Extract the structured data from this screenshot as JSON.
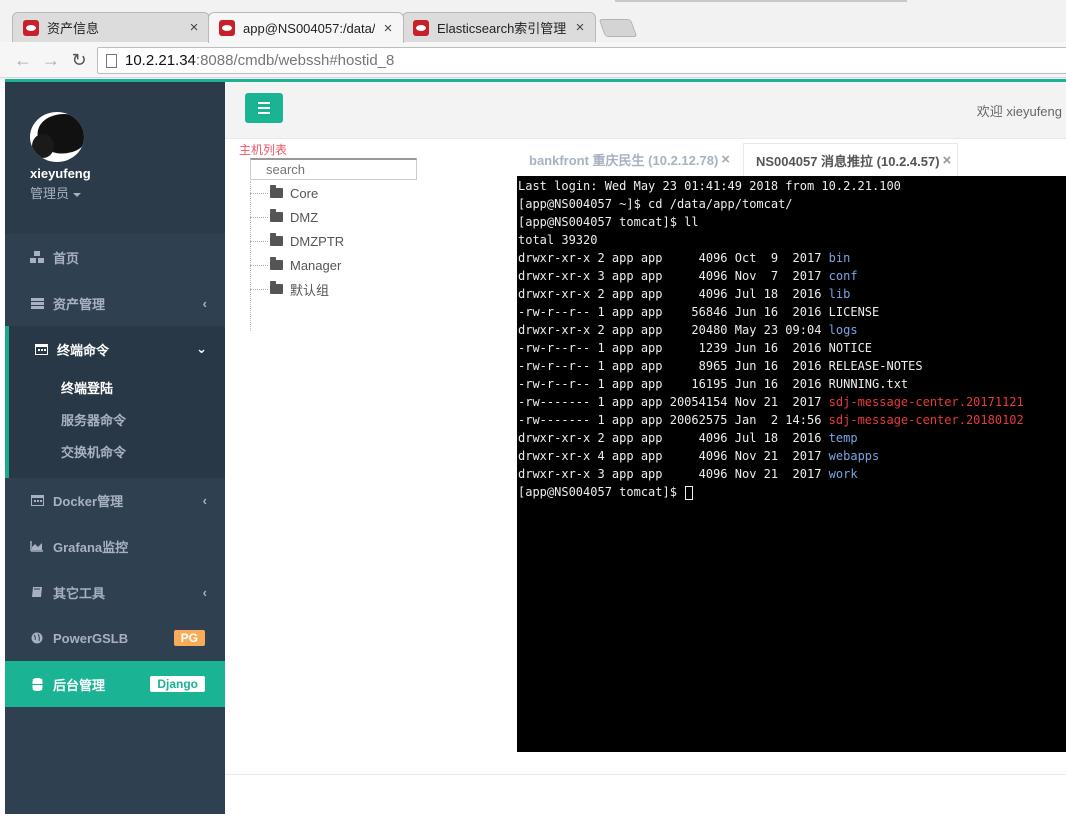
{
  "browser": {
    "tabs": [
      {
        "title": "资产信息",
        "active": false
      },
      {
        "title": "app@NS004057:/data/",
        "active": true
      },
      {
        "title": "Elasticsearch索引管理",
        "active": false
      }
    ],
    "close_glyph": "×",
    "url_host": "10.2.21.34",
    "url_rest": ":8088/cmdb/webssh#hostid_8",
    "nav_icons": {
      "back": "back-arrow-icon",
      "forward": "forward-arrow-icon",
      "reload": "reload-icon"
    }
  },
  "sidebar": {
    "username": "xieyufeng",
    "role": "管理员",
    "items": [
      {
        "label": "首页",
        "icon": "cubes-icon"
      },
      {
        "label": "资产管理",
        "icon": "server-icon",
        "chevron": "‹"
      },
      {
        "label": "终端命令",
        "icon": "calendar-icon",
        "chevron": "⌄"
      },
      {
        "label": "Docker管理",
        "icon": "calendar-icon",
        "chevron": "‹"
      },
      {
        "label": "Grafana监控",
        "icon": "area-chart-icon"
      },
      {
        "label": "其它工具",
        "icon": "book-icon",
        "chevron": "‹"
      },
      {
        "label": "PowerGSLB",
        "icon": "globe-icon",
        "badge": "PG"
      },
      {
        "label": "后台管理",
        "icon": "database-icon",
        "badge": "Django"
      }
    ],
    "subitems": [
      "终端登陆",
      "服务器命令",
      "交换机命令"
    ]
  },
  "header": {
    "welcome": "欢迎 xieyufeng"
  },
  "hostlist": {
    "title": "主机列表",
    "search_placeholder": "search",
    "groups": [
      "Core",
      "DMZ",
      "DMZPTR",
      "Manager",
      "默认组"
    ]
  },
  "session_tabs": [
    {
      "label": "bankfront 重庆民生 (10.2.12.78)",
      "active": false
    },
    {
      "label": "NS004057 消息推拉 (10.2.4.57)",
      "active": true
    }
  ],
  "terminal": {
    "lines": [
      {
        "text": "Last login: Wed May 23 01:41:49 2018 from 10.2.21.100"
      },
      {
        "text": "[app@NS004057 ~]$ cd /data/app/tomcat/"
      },
      {
        "text": "[app@NS004057 tomcat]$ ll"
      },
      {
        "text": "total 39320"
      },
      {
        "text": "drwxr-xr-x 2 app app     4096 Oct  9  2017 ",
        "name": "bin",
        "color": "dir"
      },
      {
        "text": "drwxr-xr-x 3 app app     4096 Nov  7  2017 ",
        "name": "conf",
        "color": "dir"
      },
      {
        "text": "drwxr-xr-x 2 app app     4096 Jul 18  2016 ",
        "name": "lib",
        "color": "dir"
      },
      {
        "text": "-rw-r--r-- 1 app app    56846 Jun 16  2016 ",
        "name": "LICENSE",
        "color": "plain"
      },
      {
        "text": "drwxr-xr-x 2 app app    20480 May 23 09:04 ",
        "name": "logs",
        "color": "dir"
      },
      {
        "text": "-rw-r--r-- 1 app app     1239 Jun 16  2016 ",
        "name": "NOTICE",
        "color": "plain"
      },
      {
        "text": "-rw-r--r-- 1 app app     8965 Jun 16  2016 ",
        "name": "RELEASE-NOTES",
        "color": "plain"
      },
      {
        "text": "-rw-r--r-- 1 app app    16195 Jun 16  2016 ",
        "name": "RUNNING.txt",
        "color": "plain"
      },
      {
        "text": "-rw------- 1 app app 20054154 Nov 21  2017 ",
        "name": "sdj-message-center.20171121",
        "color": "red"
      },
      {
        "text": "-rw------- 1 app app 20062575 Jan  2 14:56 ",
        "name": "sdj-message-center.20180102",
        "color": "red"
      },
      {
        "text": "drwxr-xr-x 2 app app     4096 Jul 18  2016 ",
        "name": "temp",
        "color": "dir"
      },
      {
        "text": "drwxr-xr-x 4 app app     4096 Nov 21  2017 ",
        "name": "webapps",
        "color": "dir"
      },
      {
        "text": "drwxr-xr-x 3 app app     4096 Nov 21  2017 ",
        "name": "work",
        "color": "dir"
      },
      {
        "text": "[app@NS004057 tomcat]$ ",
        "cursor": true
      }
    ],
    "colors": {
      "dir": "#7aa4e6",
      "red": "#e83a3a",
      "plain": "#ededed"
    }
  },
  "colors": {
    "accent": "#1ab394",
    "sidebar_bg": "#2f4050",
    "badge_pg": "#f8ac59"
  }
}
